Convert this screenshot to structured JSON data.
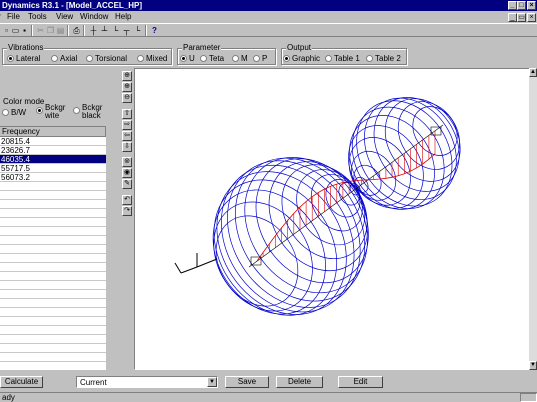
{
  "window": {
    "title": "Dynamics R3.1 - [Model_ACCEL_HP]"
  },
  "menu": [
    "File",
    "Tools",
    "View",
    "Window",
    "Help"
  ],
  "vibrations": {
    "label": "Vibrations",
    "options": [
      "Lateral",
      "Axial",
      "Torsional",
      "Mixed"
    ],
    "selected": "Lateral"
  },
  "parameter": {
    "label": "Parameter",
    "options": [
      "U",
      "Teta",
      "M",
      "P"
    ],
    "selected": "U"
  },
  "output": {
    "label": "Output",
    "options": [
      "Graphic",
      "Table 1",
      "Table 2"
    ],
    "selected": "Graphic"
  },
  "color_mode": {
    "label": "Color mode",
    "options": [
      "B/W",
      "Bckgr wite",
      "Bckgr black"
    ],
    "selected": "Bckgr wite"
  },
  "frequency": {
    "header": "Frequency",
    "values": [
      "20815.4",
      "23626.7",
      "46035.4",
      "55717.5",
      "56073.2"
    ],
    "selected_index": 2
  },
  "bottom": {
    "calculate_label": "Calculate",
    "mode_select_value": "Current",
    "save_label": "Save",
    "delete_label": "Delete",
    "edit_label": "Edit"
  },
  "status": {
    "text": "ady"
  },
  "colors": {
    "titlebar": "#000080",
    "mode_shape_outline": "#0000cc",
    "mode_shape_deflection": "#dd0000"
  }
}
